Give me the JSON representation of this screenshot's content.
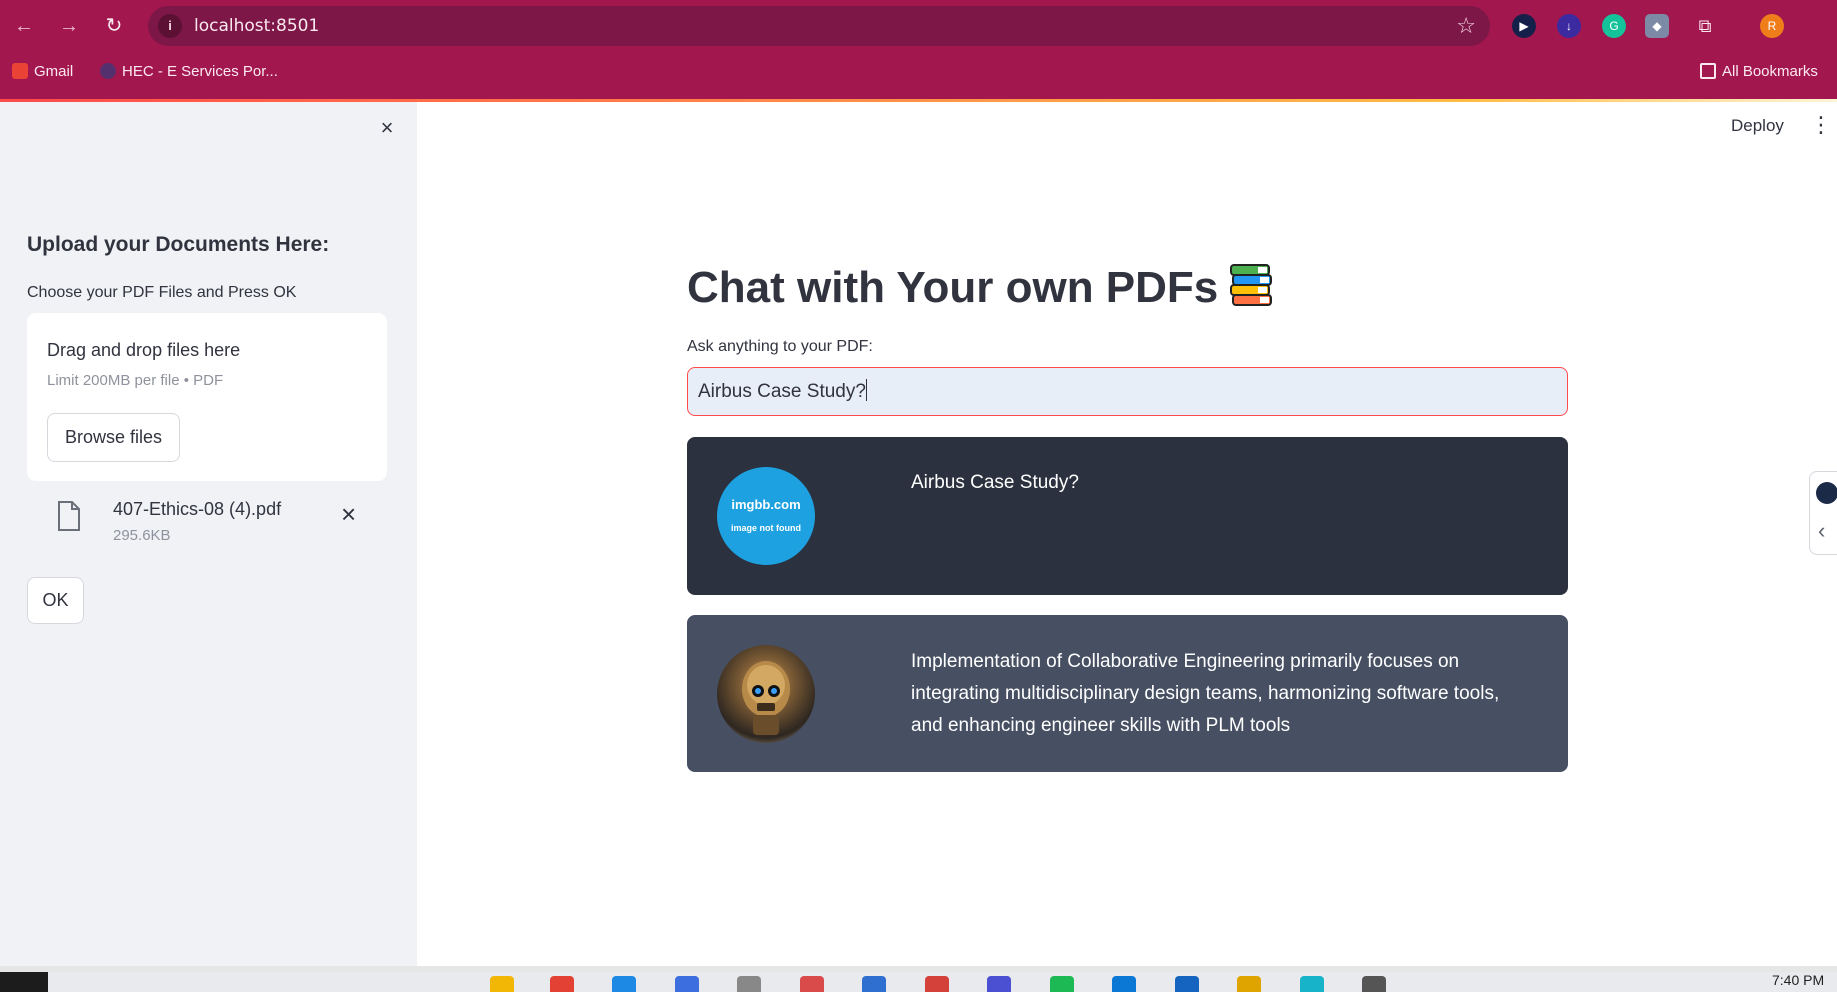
{
  "browser": {
    "url": "localhost:8501",
    "bookmarks": [
      "Gmail",
      "HEC - E Services Por...",
      "All Bookmarks"
    ],
    "profile_initial": "R"
  },
  "header": {
    "deploy_label": "Deploy",
    "menu_glyph": "⋮"
  },
  "sidebar": {
    "close_glyph": "×",
    "heading": "Upload your Documents Here:",
    "caption": "Choose your PDF Files and Press OK",
    "dropzone": {
      "title": "Drag and drop files here",
      "limit": "Limit 200MB per file • PDF",
      "browse_label": "Browse files"
    },
    "file": {
      "name": "407-Ethics-08 (4).pdf",
      "size": "295.6KB",
      "remove_glyph": "×"
    },
    "ok_label": "OK"
  },
  "main": {
    "title": "Chat with Your own PDFs",
    "ask_label": "Ask anything to your PDF:",
    "ask_value": "Airbus Case Study?",
    "messages": [
      {
        "role": "user",
        "avatar_line1": "imgbb.com",
        "avatar_line2": "image not found",
        "text": "Airbus Case Study?"
      },
      {
        "role": "bot",
        "text": "Implementation of Collaborative Engineering primarily focuses on integrating multidisciplinary design teams, harmonizing software tools, and enhancing engineer skills with PLM tools"
      }
    ]
  },
  "taskbar": {
    "clock": "7:40 PM"
  },
  "colors": {
    "chrome": "#a3174f",
    "accent": "#ff4b4b",
    "sidebar_bg": "#f0f2f6",
    "user_msg_bg": "#2b313e",
    "bot_msg_bg": "#475063"
  }
}
